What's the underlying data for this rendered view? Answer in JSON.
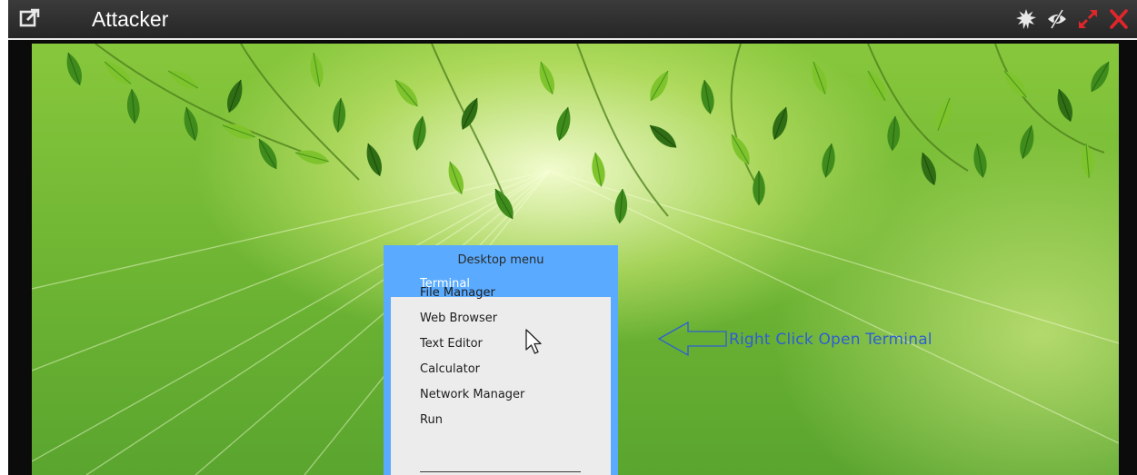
{
  "window": {
    "title": "Attacker",
    "icons": [
      "popout-icon",
      "settings-icon",
      "visibility-icon",
      "resize-icon",
      "close-icon"
    ],
    "accent_color": "#e0262b"
  },
  "desktop_menu": {
    "title": "Desktop menu",
    "items": [
      {
        "label": "Terminal",
        "active": true
      },
      {
        "label": "File Manager"
      },
      {
        "label": "Web Browser"
      },
      {
        "label": "Text Editor"
      },
      {
        "label": "Calculator"
      },
      {
        "label": "Network Manager"
      },
      {
        "label": "Run"
      }
    ],
    "highlight_color": "#5aabff"
  },
  "annotation": {
    "text": "Right Click Open Terminal",
    "color": "#2e5fd2"
  }
}
